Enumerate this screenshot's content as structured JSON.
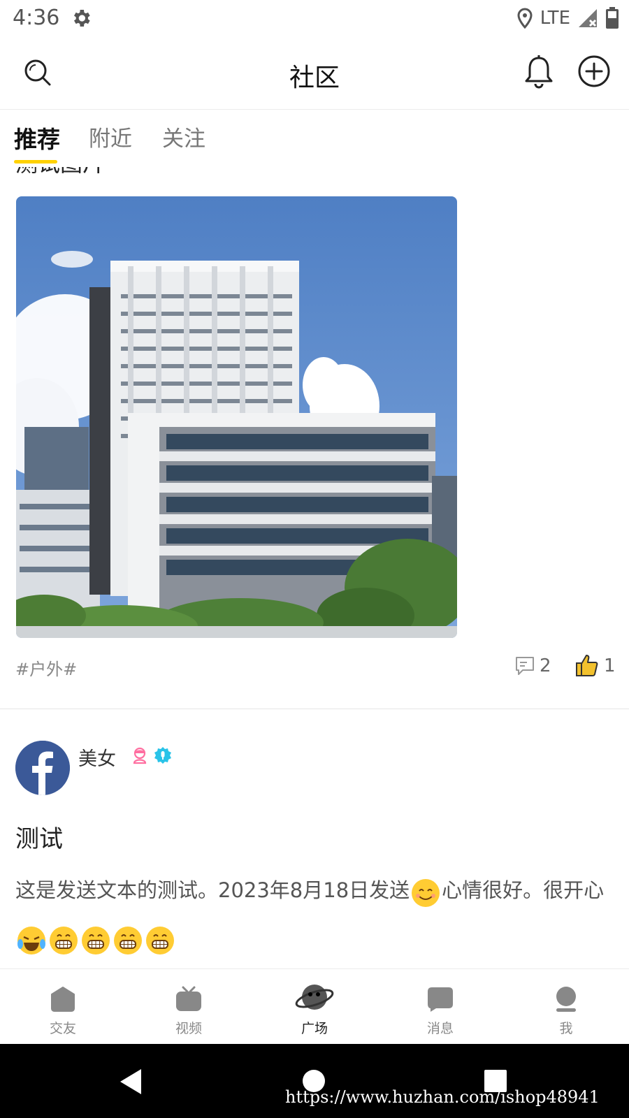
{
  "status_bar": {
    "time": "4:36",
    "network": "LTE"
  },
  "header": {
    "title": "社区"
  },
  "tabs": [
    {
      "label": "推荐",
      "active": true
    },
    {
      "label": "附近",
      "active": false
    },
    {
      "label": "关注",
      "active": false
    }
  ],
  "post1": {
    "title": "测试图片",
    "tag": "#户外#",
    "comments": "2",
    "likes": "1"
  },
  "post2": {
    "username": "美女",
    "title": "测试",
    "body_part1": "这是发送文本的测试。2023年8月18日发送",
    "body_part2": "心情很好。很开心"
  },
  "bottom_nav": [
    {
      "label": "交友"
    },
    {
      "label": "视频"
    },
    {
      "label": "广场"
    },
    {
      "label": "消息"
    },
    {
      "label": "我"
    }
  ],
  "watermark": "https://www.huzhan.com/ishop48941",
  "colors": {
    "accent": "#ffd100",
    "like": "#f2c12e",
    "avatar": "#3b5998",
    "verify": "#29c3e8",
    "gender": "#ff6ea0"
  }
}
